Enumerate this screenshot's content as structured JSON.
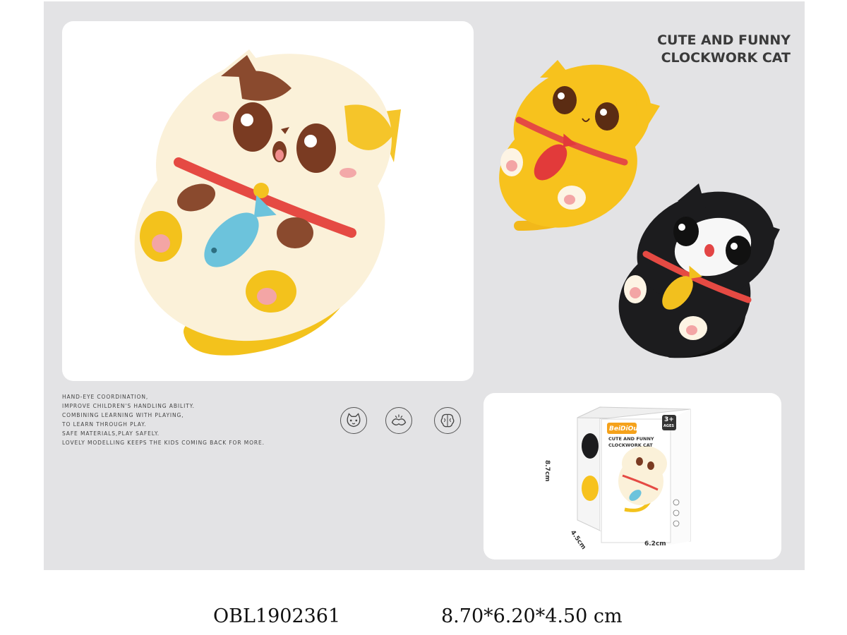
{
  "title": {
    "line1": "CUTE AND FUNNY",
    "line2": "CLOCKWORK CAT"
  },
  "features": [
    "HAND-EYE COORDINATION,",
    "IMPROVE CHILDREN'S HANDLING ABILITY.",
    "COMBINING LEARNING WITH PLAYING,",
    "TO LEARN THROUGH PLAY.",
    "SAFE MATERIALS,PLAY SAFELY.",
    "LOVELY MODELLING KEEPS THE KIDS COMING BACK FOR MORE."
  ],
  "feature_icons": [
    "cat-face-icon",
    "hands-icon",
    "brain-icon"
  ],
  "package": {
    "brand": "BeiDiOu",
    "age": "3+",
    "age_sub": "AGES",
    "name_line1": "CUTE AND FUNNY",
    "name_line2": "CLOCKWORK CAT",
    "height_label": "8.7cm",
    "depth_label": "4.5cm",
    "width_label": "6.2cm"
  },
  "product": {
    "code": "OBL1902361",
    "size": "8.70*6.20*4.50 cm"
  },
  "colors": {
    "cream_cat": "#fbf1d9",
    "yellow_cat": "#f7c21d",
    "black_cat": "#1c1c1e",
    "collar": "#e54a43",
    "fish_blue": "#6cc3dc",
    "tail_yellow": "#f6cf22"
  }
}
